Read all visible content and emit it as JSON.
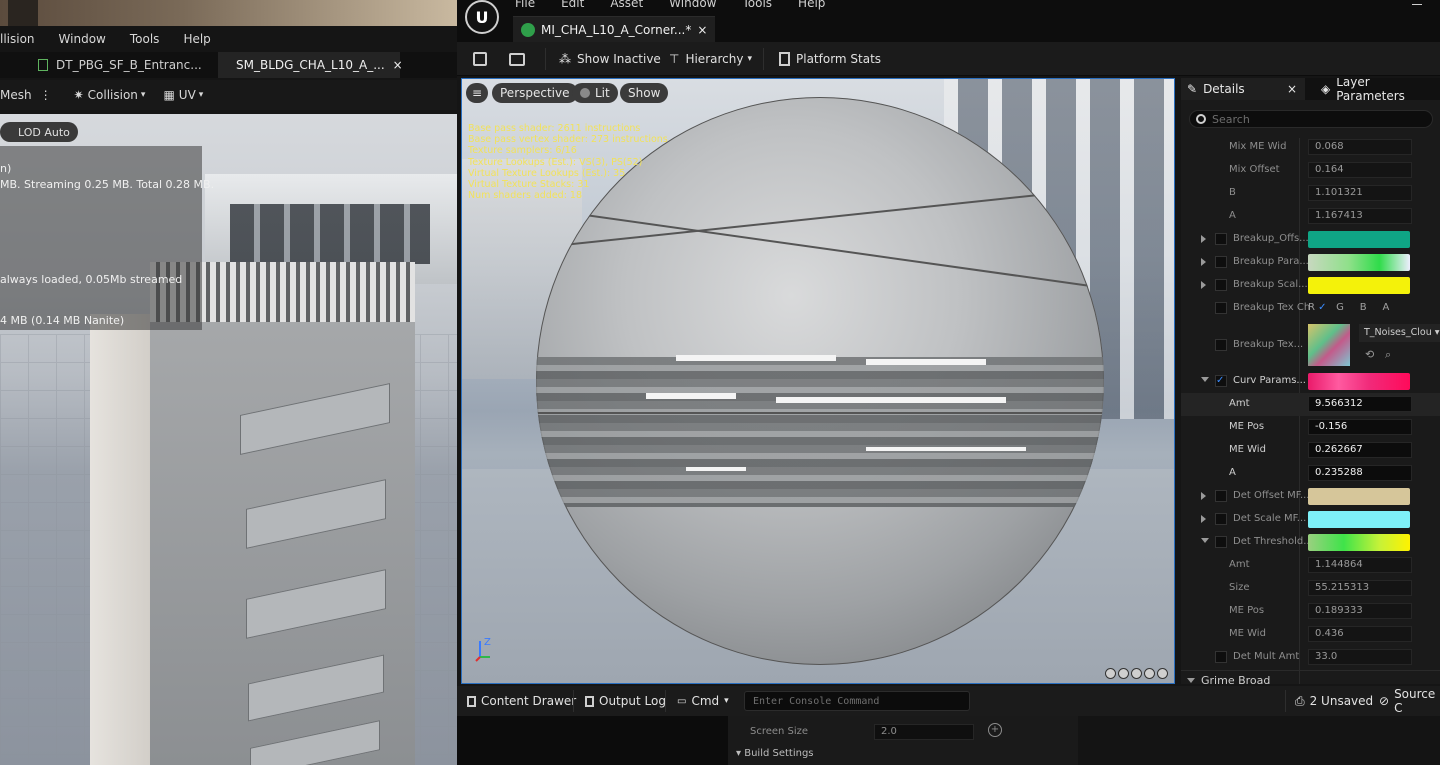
{
  "left_window": {
    "menu": [
      "llision",
      "Window",
      "Tools",
      "Help"
    ],
    "tabs": [
      {
        "label": "DT_PBG_SF_B_Entranc...",
        "active": false
      },
      {
        "label": "SM_BLDG_CHA_L10_A_...",
        "active": true,
        "close": "×"
      }
    ],
    "toolbar": {
      "mesh": "Mesh",
      "collision": "Collision",
      "uv": "UV"
    },
    "lod_button": "LOD Auto",
    "stats": [
      "n)",
      "MB. Streaming 0.25 MB. Total 0.28 MB.",
      "always loaded, 0.05Mb streamed",
      "4 MB (0.14 MB Nanite)"
    ]
  },
  "right_window": {
    "menu": [
      "File",
      "Edit",
      "Asset",
      "Window",
      "Tools",
      "Help"
    ],
    "tab": {
      "label": "MI_CHA_L10_A_Corner...*",
      "close": "×"
    },
    "toolbar": {
      "show_inactive": "Show Inactive",
      "hierarchy": "Hierarchy",
      "platform_stats": "Platform Stats"
    },
    "viewport": {
      "perspective": "Perspective",
      "lit": "Lit",
      "show": "Show",
      "shader_stats": [
        "Base pass shader: 2611 instructions",
        "Base pass vertex shader: 273 instructions",
        "Texture samplers: 6/16",
        "Texture Lookups (Est.): VS(3), PS(52)",
        "Virtual Texture Lookups (Est.): 35",
        "Virtual Texture Stacks: 31",
        "Num shaders added: 18"
      ],
      "axis_label": "Z"
    },
    "details": {
      "tab_details": "Details",
      "tab_close": "×",
      "tab_layer": "Layer Parameters",
      "search_placeholder": "Search",
      "rows": {
        "mix_me_wid": {
          "label": "Mix ME Wid",
          "value": "0.068"
        },
        "mix_offset": {
          "label": "Mix Offset",
          "value": "0.164"
        },
        "b": {
          "label": "B",
          "value": "1.101321"
        },
        "a": {
          "label": "A",
          "value": "1.167413"
        },
        "breakup_offs": {
          "label": "Breakup_Offs...",
          "color": "#0fa585"
        },
        "breakup_para": {
          "label": "Breakup Para..."
        },
        "breakup_scal": {
          "label": "Breakup Scal...",
          "color": "#f4f20a"
        },
        "breakup_tex_ch": {
          "label": "Breakup Tex Ch",
          "r": "R",
          "g": "G",
          "b": "B",
          "a": "A"
        },
        "breakup_tex": {
          "label": "Breakup Tex...",
          "texture": "T_Noises_Clou"
        },
        "curv_params": {
          "label": "Curv Params..."
        },
        "amt": {
          "label": "Amt",
          "value": "9.566312"
        },
        "me_pos": {
          "label": "ME Pos",
          "value": "-0.156"
        },
        "me_wid": {
          "label": "ME Wid",
          "value": "0.262667"
        },
        "a2": {
          "label": "A",
          "value": "0.235288"
        },
        "det_offset": {
          "label": "Det Offset MF...",
          "color": "#d6c69a"
        },
        "det_scale": {
          "label": "Det Scale MF...",
          "color": "#7ef0f8"
        },
        "det_threshold": {
          "label": "Det Threshold..."
        },
        "amt2": {
          "label": "Amt",
          "value": "1.144864"
        },
        "size": {
          "label": "Size",
          "value": "55.215313"
        },
        "me_pos2": {
          "label": "ME Pos",
          "value": "0.189333"
        },
        "me_wid2": {
          "label": "ME Wid",
          "value": "0.436"
        },
        "det_mult_amt": {
          "label": "Det Mult Amt",
          "value": "33.0"
        },
        "grime_broad": {
          "label": "Grime Broad"
        }
      }
    },
    "bottom": {
      "content_drawer": "Content Drawer",
      "output_log": "Output Log",
      "cmd": "Cmd",
      "console_placeholder": "Enter Console Command",
      "unsaved": "2 Unsaved",
      "source": "Source C"
    },
    "lower": {
      "screen_size_label": "Screen Size",
      "screen_size_value": "2.0",
      "build_settings": "Build Settings"
    }
  }
}
